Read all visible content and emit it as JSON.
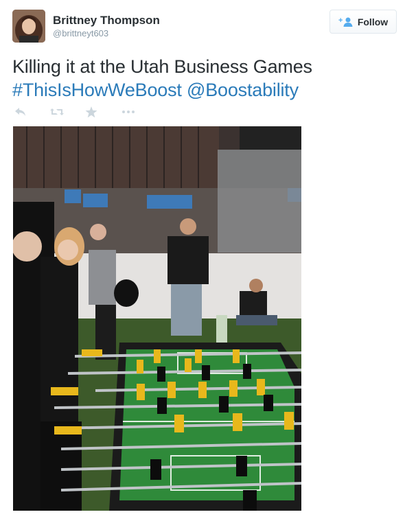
{
  "user": {
    "name": "Brittney Thompson",
    "handle": "@brittneyt603"
  },
  "follow_button": {
    "label": "Follow",
    "icon": "add-user-icon"
  },
  "tweet": {
    "text": "Killing it at the Utah Business Games",
    "hashtag": "#ThisIsHowWeBoost",
    "mention": "@Boostability"
  },
  "actions": [
    {
      "name": "reply",
      "icon": "reply-icon"
    },
    {
      "name": "retweet",
      "icon": "retweet-icon"
    },
    {
      "name": "favorite",
      "icon": "star-icon"
    },
    {
      "name": "more",
      "icon": "more-icon"
    }
  ],
  "colors": {
    "link": "#2b7bb9",
    "text": "#292f33",
    "muted": "#8899a6",
    "action_icon": "#ccd6dd"
  }
}
